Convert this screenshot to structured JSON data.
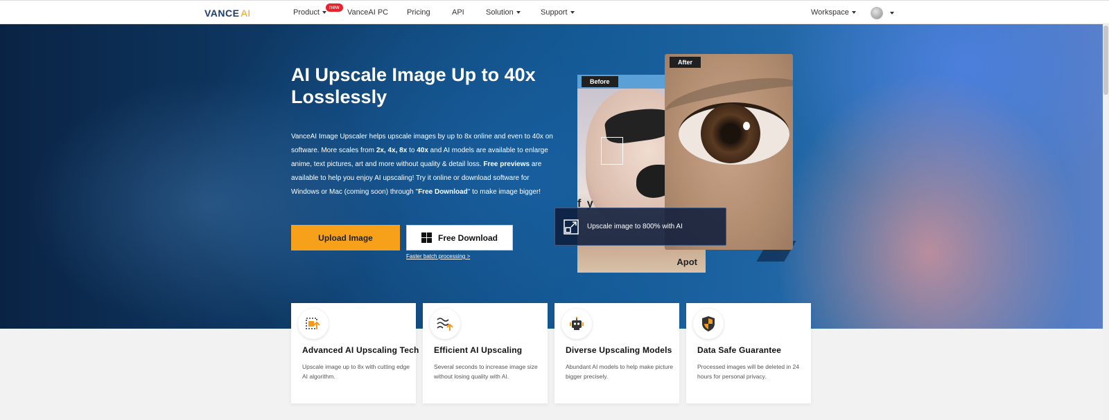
{
  "nav": {
    "logo_main": "VANCE",
    "logo_ai": "AI",
    "items": [
      {
        "label": "Product",
        "has_caret": true
      },
      {
        "label": "VanceAI PC"
      },
      {
        "label": "Pricing"
      },
      {
        "label": "API"
      },
      {
        "label": "Solution",
        "has_caret": true
      },
      {
        "label": "Support",
        "has_caret": true
      }
    ],
    "new_badge": "new",
    "workspace": "Workspace"
  },
  "hero": {
    "title": "AI Upscale Image Up to 40x Losslessly",
    "desc_parts": [
      "VanceAI Image Upscaler helps upscale images by up to 8x online and even to 40x on software. More scales from ",
      "2x, 4x, 8x",
      " to ",
      "40x",
      " and AI models are available to enlarge anime, text pictures, art and more without quality & detail loss. ",
      "Free previews",
      " are available to help you enjoy AI upscaling! Try it online or download software for Windows or Mac (coming soon) through \"",
      "Free Download",
      "\" to make image bigger!"
    ],
    "upload_button": "Upload Image",
    "download_button": "Free Download",
    "faster_link": "Faster batch processing >",
    "before_label": "Before",
    "after_label": "After",
    "brand_text": "Apot",
    "fy_text": "f y",
    "caption": "Upscale image to 800% with AI"
  },
  "features": [
    {
      "icon": "upscale-tech-icon",
      "title": "Advanced AI Upscaling Tech",
      "desc": "Upscale image up to 8x with cutting edge AI algorithm."
    },
    {
      "icon": "efficient-upscale-icon",
      "title": "Efficient AI Upscaling",
      "desc": "Several seconds to increase image size without losing quality with AI."
    },
    {
      "icon": "robot-icon",
      "title": "Diverse Upscaling Models",
      "desc": "Abundant AI models to help make picture bigger precisely."
    },
    {
      "icon": "shield-icon",
      "title": "Data Safe Guarantee",
      "desc": "Processed images will be deleted in 24 hours for personal privacy."
    }
  ],
  "colors": {
    "accent": "#f7a11a",
    "brand_blue": "#1d3c6e",
    "badge_red": "#e8232c"
  }
}
